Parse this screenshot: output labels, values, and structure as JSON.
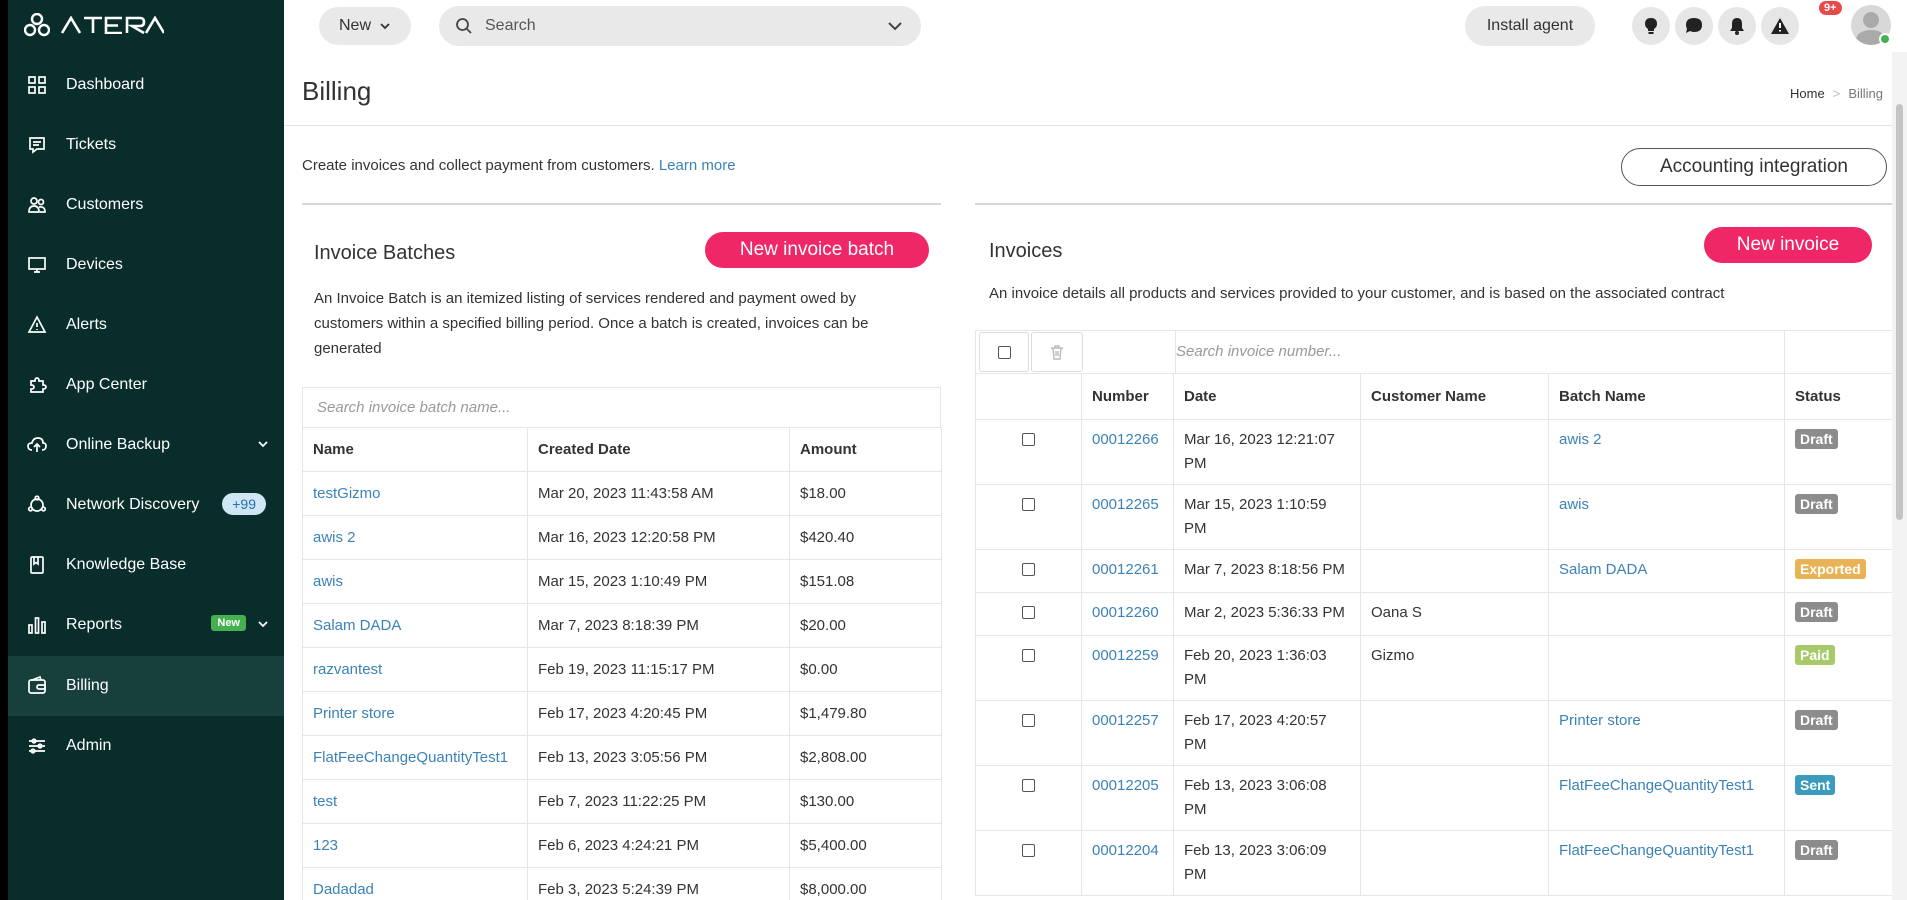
{
  "sidebar": {
    "logo_text": "ATERA",
    "items": [
      {
        "label": "Dashboard",
        "icon": "dashboard-icon"
      },
      {
        "label": "Tickets",
        "icon": "tickets-icon"
      },
      {
        "label": "Customers",
        "icon": "customers-icon"
      },
      {
        "label": "Devices",
        "icon": "devices-icon"
      },
      {
        "label": "Alerts",
        "icon": "alerts-icon"
      },
      {
        "label": "App Center",
        "icon": "app-center-icon"
      },
      {
        "label": "Online Backup",
        "icon": "cloud-backup-icon"
      },
      {
        "label": "Network Discovery",
        "icon": "network-discovery-icon",
        "badge": "+99"
      },
      {
        "label": "Knowledge Base",
        "icon": "knowledge-base-icon"
      },
      {
        "label": "Reports",
        "icon": "reports-icon",
        "badge": "New"
      },
      {
        "label": "Billing",
        "icon": "billing-icon",
        "active": true
      },
      {
        "label": "Admin",
        "icon": "admin-icon"
      }
    ]
  },
  "topbar": {
    "new_label": "New",
    "search_placeholder": "Search",
    "install_agent_label": "Install agent",
    "alerts_badge": "9+"
  },
  "page": {
    "title": "Billing",
    "breadcrumb_home": "Home",
    "breadcrumb_sep": ">",
    "breadcrumb_current": "Billing",
    "intro_text": "Create invoices and collect payment from customers.",
    "intro_link": "Learn more",
    "accounting_button": "Accounting integration"
  },
  "batches": {
    "title": "Invoice Batches",
    "new_button": "New invoice batch",
    "description": "An Invoice Batch is an itemized listing of services rendered and payment owed by customers within a specified billing period. Once a batch is created, invoices can be generated",
    "search_placeholder": "Search invoice batch name...",
    "columns": [
      "Name",
      "Created Date",
      "Amount"
    ],
    "rows": [
      [
        "testGizmo",
        "Mar 20, 2023 11:43:58 AM",
        "$18.00"
      ],
      [
        "awis 2",
        "Mar 16, 2023 12:20:58 PM",
        "$420.40"
      ],
      [
        "awis",
        "Mar 15, 2023 1:10:49 PM",
        "$151.08"
      ],
      [
        "Salam DADA",
        "Mar 7, 2023 8:18:39 PM",
        "$20.00"
      ],
      [
        "razvantest",
        "Feb 19, 2023 11:15:17 PM",
        "$0.00"
      ],
      [
        "Printer store",
        "Feb 17, 2023 4:20:45 PM",
        "$1,479.80"
      ],
      [
        "FlatFeeChangeQuantityTest1",
        "Feb 13, 2023 3:05:56 PM",
        "$2,808.00"
      ],
      [
        "test",
        "Feb 7, 2023 11:22:25 PM",
        "$130.00"
      ],
      [
        "123",
        "Feb 6, 2023 4:24:21 PM",
        "$5,400.00"
      ],
      [
        "Dadadad",
        "Feb 3, 2023 5:24:39 PM",
        "$8,000.00"
      ]
    ]
  },
  "invoices": {
    "title": "Invoices",
    "new_button": "New invoice",
    "description": "An invoice details all products and services provided to your customer, and is based on the associated contract",
    "search_placeholder": "Search invoice number...",
    "columns": [
      "",
      "Number",
      "Date",
      "Customer Name",
      "Batch Name",
      "Status"
    ],
    "rows": [
      {
        "number": "00012266",
        "date": "Mar 16, 2023 12:21:07 PM",
        "customer": "",
        "batch": "awis 2",
        "status": "Draft"
      },
      {
        "number": "00012265",
        "date": "Mar 15, 2023 1:10:59 PM",
        "customer": "",
        "batch": "awis",
        "status": "Draft"
      },
      {
        "number": "00012261",
        "date": "Mar 7, 2023 8:18:56 PM",
        "customer": "",
        "batch": "Salam DADA",
        "status": "Exported"
      },
      {
        "number": "00012260",
        "date": "Mar 2, 2023 5:36:33 PM",
        "customer": "Oana S",
        "batch": "",
        "status": "Draft"
      },
      {
        "number": "00012259",
        "date": "Feb 20, 2023 1:36:03 PM",
        "customer": "Gizmo",
        "batch": "",
        "status": "Paid"
      },
      {
        "number": "00012257",
        "date": "Feb 17, 2023 4:20:57 PM",
        "customer": "",
        "batch": "Printer store",
        "status": "Draft"
      },
      {
        "number": "00012205",
        "date": "Feb 13, 2023 3:06:08 PM",
        "customer": "",
        "batch": "FlatFeeChangeQuantityTest1",
        "status": "Sent"
      },
      {
        "number": "00012204",
        "date": "Feb 13, 2023 3:06:09 PM",
        "customer": "",
        "batch": "FlatFeeChangeQuantityTest1",
        "status": "Draft"
      }
    ]
  },
  "colors": {
    "sidebar_bg": "#082d2a",
    "accent_pink": "#ef2766",
    "link_blue": "#3b82b8",
    "status_draft": "#8c8c8c",
    "status_exported": "#e8b354",
    "status_paid": "#a8c96a",
    "status_sent": "#3a9bbd"
  }
}
